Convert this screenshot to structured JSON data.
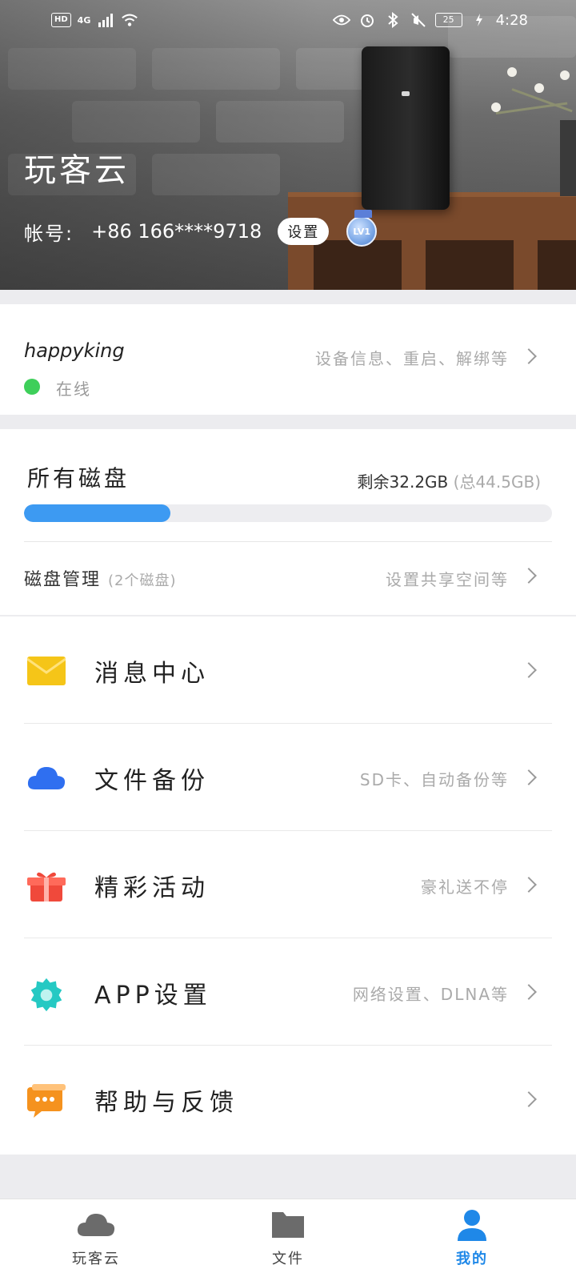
{
  "status_bar": {
    "network_badge": "HD",
    "signal_label": "4G",
    "battery": "25",
    "time": "4:28"
  },
  "header": {
    "title": "玩客云",
    "account_label": "帐号:",
    "account_value": "+86 166****9718",
    "settings_button": "设置",
    "level_badge": "LV1"
  },
  "device_card": {
    "name": "happyking",
    "status": "在线",
    "status_color": "#3ecf5a",
    "hint": "设备信息、重启、解绑等"
  },
  "disk_card": {
    "title": "所有磁盘",
    "remaining": "剩余32.2GB",
    "total": "(总44.5GB)",
    "used_fraction": 0.277,
    "manage_label": "磁盘管理",
    "manage_sub": "(2个磁盘)",
    "manage_hint": "设置共享空间等"
  },
  "menu": {
    "items": [
      {
        "label": "消息中心",
        "hint": "",
        "icon": "mail-icon",
        "color": "#f5c518"
      },
      {
        "label": "文件备份",
        "hint": "SD卡、自动备份等",
        "icon": "cloud-icon",
        "color": "#2f6ff0"
      },
      {
        "label": "精彩活动",
        "hint": "豪礼送不停",
        "icon": "gift-icon",
        "color": "#f0493b"
      },
      {
        "label": "APP设置",
        "hint": "网络设置、DLNA等",
        "icon": "gear-icon",
        "color": "#25c9c3"
      },
      {
        "label": "帮助与反馈",
        "hint": "",
        "icon": "chat-icon",
        "color": "#f5921e"
      }
    ]
  },
  "bottom_nav": {
    "items": [
      {
        "label": "玩客云",
        "icon": "cloud-icon"
      },
      {
        "label": "文件",
        "icon": "folder-icon"
      },
      {
        "label": "我的",
        "icon": "person-icon"
      }
    ],
    "active_color": "#1f88e8"
  }
}
